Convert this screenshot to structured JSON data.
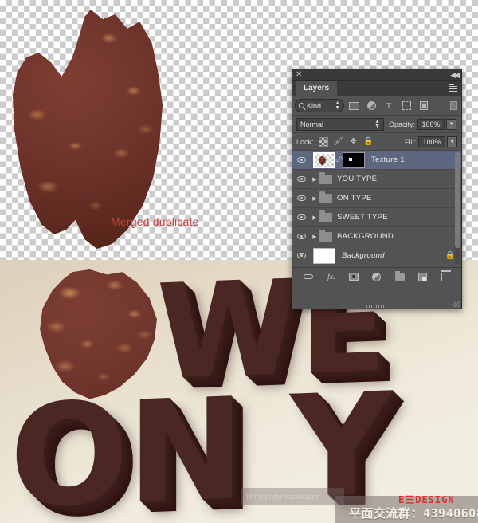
{
  "canvas": {
    "top": {
      "annotation": "Merged duplicate",
      "annotation_color": "#c0443c",
      "background": "transparent-checkerboard"
    },
    "bottom": {
      "headline_line1": "WE",
      "headline_line2": "ON Y",
      "translation_watermark": "Third party translation",
      "brand_logo": "E三DESIGN",
      "qq_line": "平面交流群：43940608"
    }
  },
  "panel": {
    "titlebar": {
      "close_icon": "✕",
      "collapse_icon": "◀◀"
    },
    "tab": "Layers",
    "menu_icon": "panel-menu-icon",
    "filter": {
      "kind_label": "Kind",
      "search_icon": "search-icon",
      "stepper_icon": "▲▼",
      "icons": [
        {
          "name": "filter-pixel-icon",
          "glyph": ""
        },
        {
          "name": "filter-adjustment-icon",
          "glyph": ""
        },
        {
          "name": "filter-type-icon",
          "glyph": "T"
        },
        {
          "name": "filter-shape-icon",
          "glyph": ""
        },
        {
          "name": "filter-smart-object-icon",
          "glyph": ""
        }
      ],
      "toggle_filter_label": "filter-toggle"
    },
    "blend": {
      "mode": "Normal",
      "mode_arrow": "⇕",
      "opacity_label": "Opacity:",
      "opacity_value": "100%",
      "fill_label": "Fill:",
      "fill_value": "100%",
      "drop_arrow": "▼"
    },
    "lock": {
      "label": "Lock:",
      "icons": [
        {
          "name": "lock-transparency-icon",
          "glyph": ""
        },
        {
          "name": "lock-image-pixels-icon",
          "glyph": "🖌"
        },
        {
          "name": "lock-position-icon",
          "glyph": "✥"
        },
        {
          "name": "lock-all-icon",
          "glyph": "🔒"
        }
      ]
    },
    "layers": [
      {
        "name": "Texture 1",
        "type": "image-with-mask",
        "selected": true,
        "visible": true,
        "italic": false,
        "locked": false,
        "expandable": false
      },
      {
        "name": "YOU TYPE",
        "type": "group",
        "selected": false,
        "visible": true,
        "italic": false,
        "locked": false,
        "expandable": true
      },
      {
        "name": "ON TYPE",
        "type": "group",
        "selected": false,
        "visible": true,
        "italic": false,
        "locked": false,
        "expandable": true
      },
      {
        "name": "SWEET TYPE",
        "type": "group",
        "selected": false,
        "visible": true,
        "italic": false,
        "locked": false,
        "expandable": true
      },
      {
        "name": "BACKGROUND",
        "type": "group",
        "selected": false,
        "visible": true,
        "italic": false,
        "locked": false,
        "expandable": true
      },
      {
        "name": "Background",
        "type": "background",
        "selected": false,
        "visible": true,
        "italic": true,
        "locked": true,
        "expandable": false
      }
    ],
    "footer_buttons": [
      {
        "name": "link-layers-button",
        "glyph": ""
      },
      {
        "name": "layer-style-fx-button",
        "glyph": "fx."
      },
      {
        "name": "add-layer-mask-button",
        "glyph": ""
      },
      {
        "name": "new-adjustment-layer-button",
        "glyph": ""
      },
      {
        "name": "new-group-button",
        "glyph": ""
      },
      {
        "name": "new-layer-button",
        "glyph": ""
      },
      {
        "name": "delete-layer-button",
        "glyph": ""
      }
    ],
    "colors": {
      "panel_bg": "#535353",
      "header_bg": "#3a3a3a",
      "selected_row": "#5e6780",
      "text": "#e6e6e6"
    }
  }
}
